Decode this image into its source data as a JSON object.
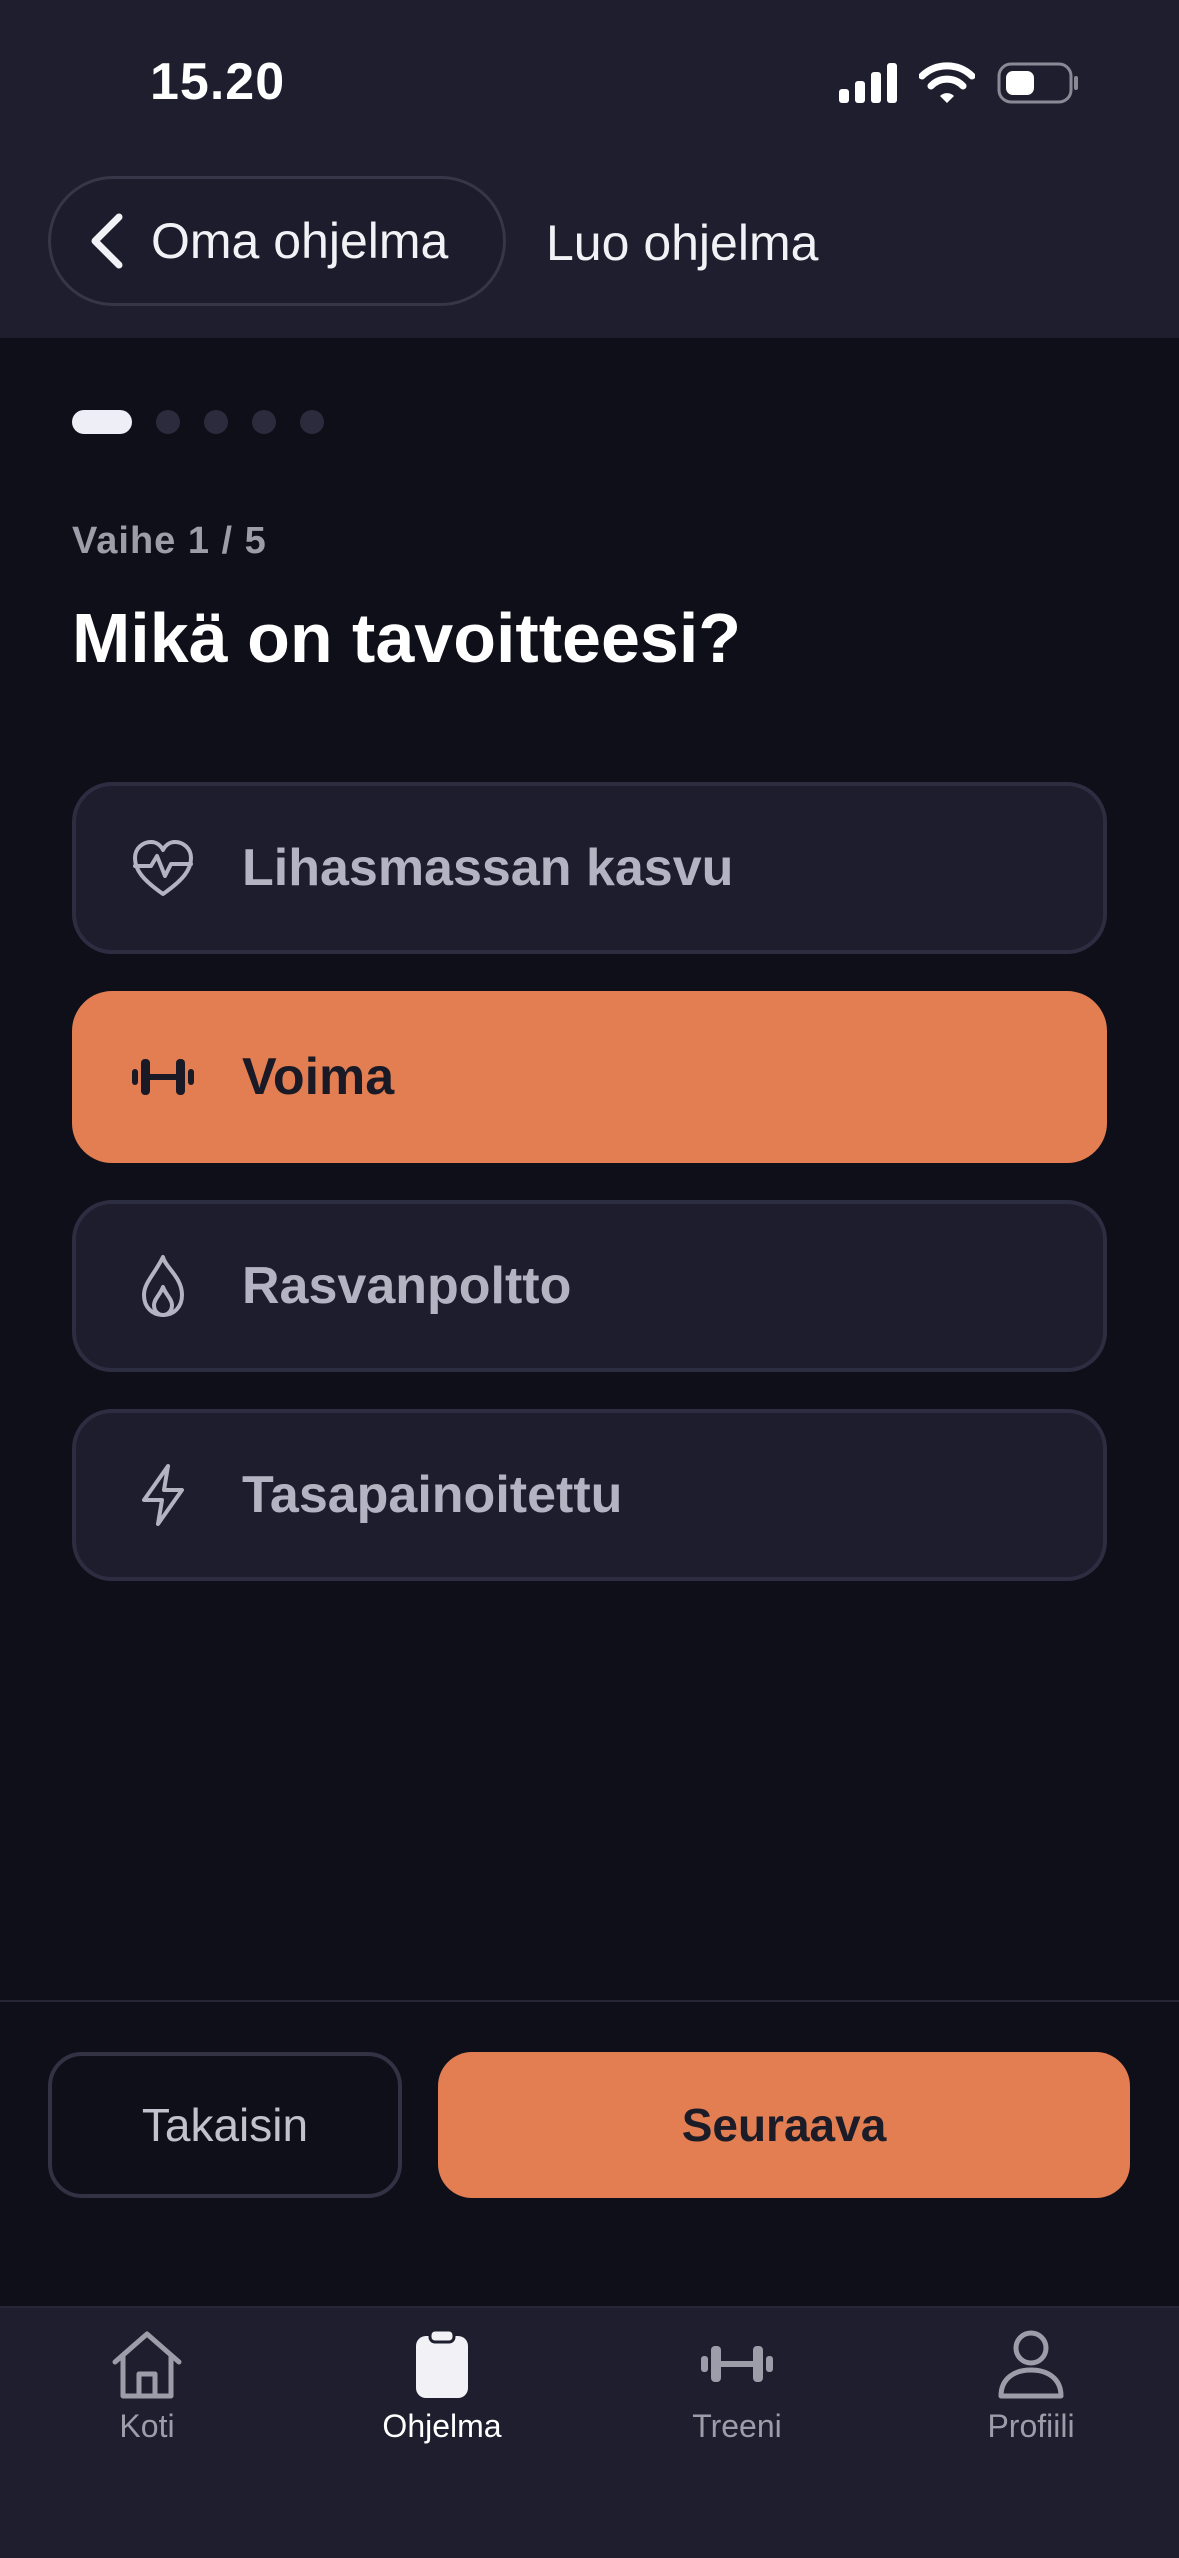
{
  "status_bar": {
    "time": "15.20"
  },
  "header": {
    "back_label": "Oma ohjelma",
    "title": "Luo ohjelma"
  },
  "progress": {
    "total_steps": 5,
    "current_step": 1
  },
  "step_label": "Vaihe 1 / 5",
  "question": "Mikä on tavoitteesi?",
  "options": [
    {
      "label": "Lihasmassan kasvu",
      "icon": "heart-pulse-icon",
      "selected": false
    },
    {
      "label": "Voima",
      "icon": "dumbbell-icon",
      "selected": true
    },
    {
      "label": "Rasvanpoltto",
      "icon": "flame-icon",
      "selected": false
    },
    {
      "label": "Tasapainoitettu",
      "icon": "lightning-icon",
      "selected": false
    }
  ],
  "actions": {
    "back_label": "Takaisin",
    "next_label": "Seuraava"
  },
  "tabs": [
    {
      "label": "Koti",
      "icon": "home-icon",
      "active": false
    },
    {
      "label": "Ohjelma",
      "icon": "clipboard-icon",
      "active": true
    },
    {
      "label": "Treeni",
      "icon": "dumbbell-icon",
      "active": false
    },
    {
      "label": "Profiili",
      "icon": "user-icon",
      "active": false
    }
  ],
  "colors": {
    "accent": "#e27e52",
    "background": "#0f0f19",
    "surface": "#1e1e2e"
  }
}
